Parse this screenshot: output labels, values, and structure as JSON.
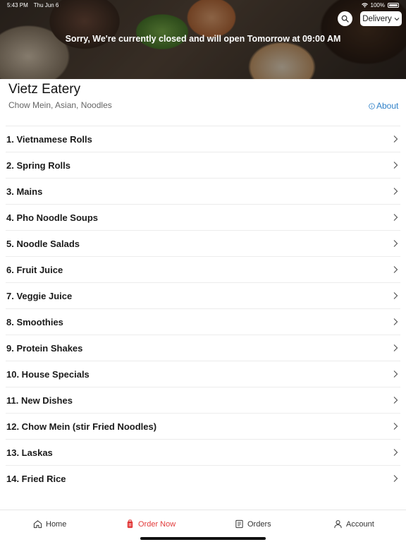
{
  "status_bar": {
    "time": "5:43 PM",
    "date": "Thu Jun 6",
    "battery": "100%"
  },
  "header": {
    "closed_message": "Sorry, We're currently closed and will open Tomorrow at 09:00 AM",
    "search_icon": "search-icon",
    "delivery_label": "Delivery"
  },
  "restaurant": {
    "name": "Vietz Eatery",
    "cuisines": "Chow Mein, Asian, Noodles",
    "about_label": "About"
  },
  "categories": [
    "1. Vietnamese Rolls",
    "2. Spring Rolls",
    "3. Mains",
    "4. Pho Noodle Soups",
    "5. Noodle Salads",
    "6. Fruit Juice",
    "7. Veggie Juice",
    "8. Smoothies",
    "9. Protein Shakes",
    "10. House Specials",
    "11. New Dishes",
    "12. Chow Mein (stir Fried Noodles)",
    "13. Laskas",
    "14. Fried Rice"
  ],
  "tabbar": {
    "home": "Home",
    "order_now": "Order Now",
    "orders": "Orders",
    "account": "Account"
  },
  "colors": {
    "accent": "#e23b3b",
    "link": "#2f80c8"
  }
}
